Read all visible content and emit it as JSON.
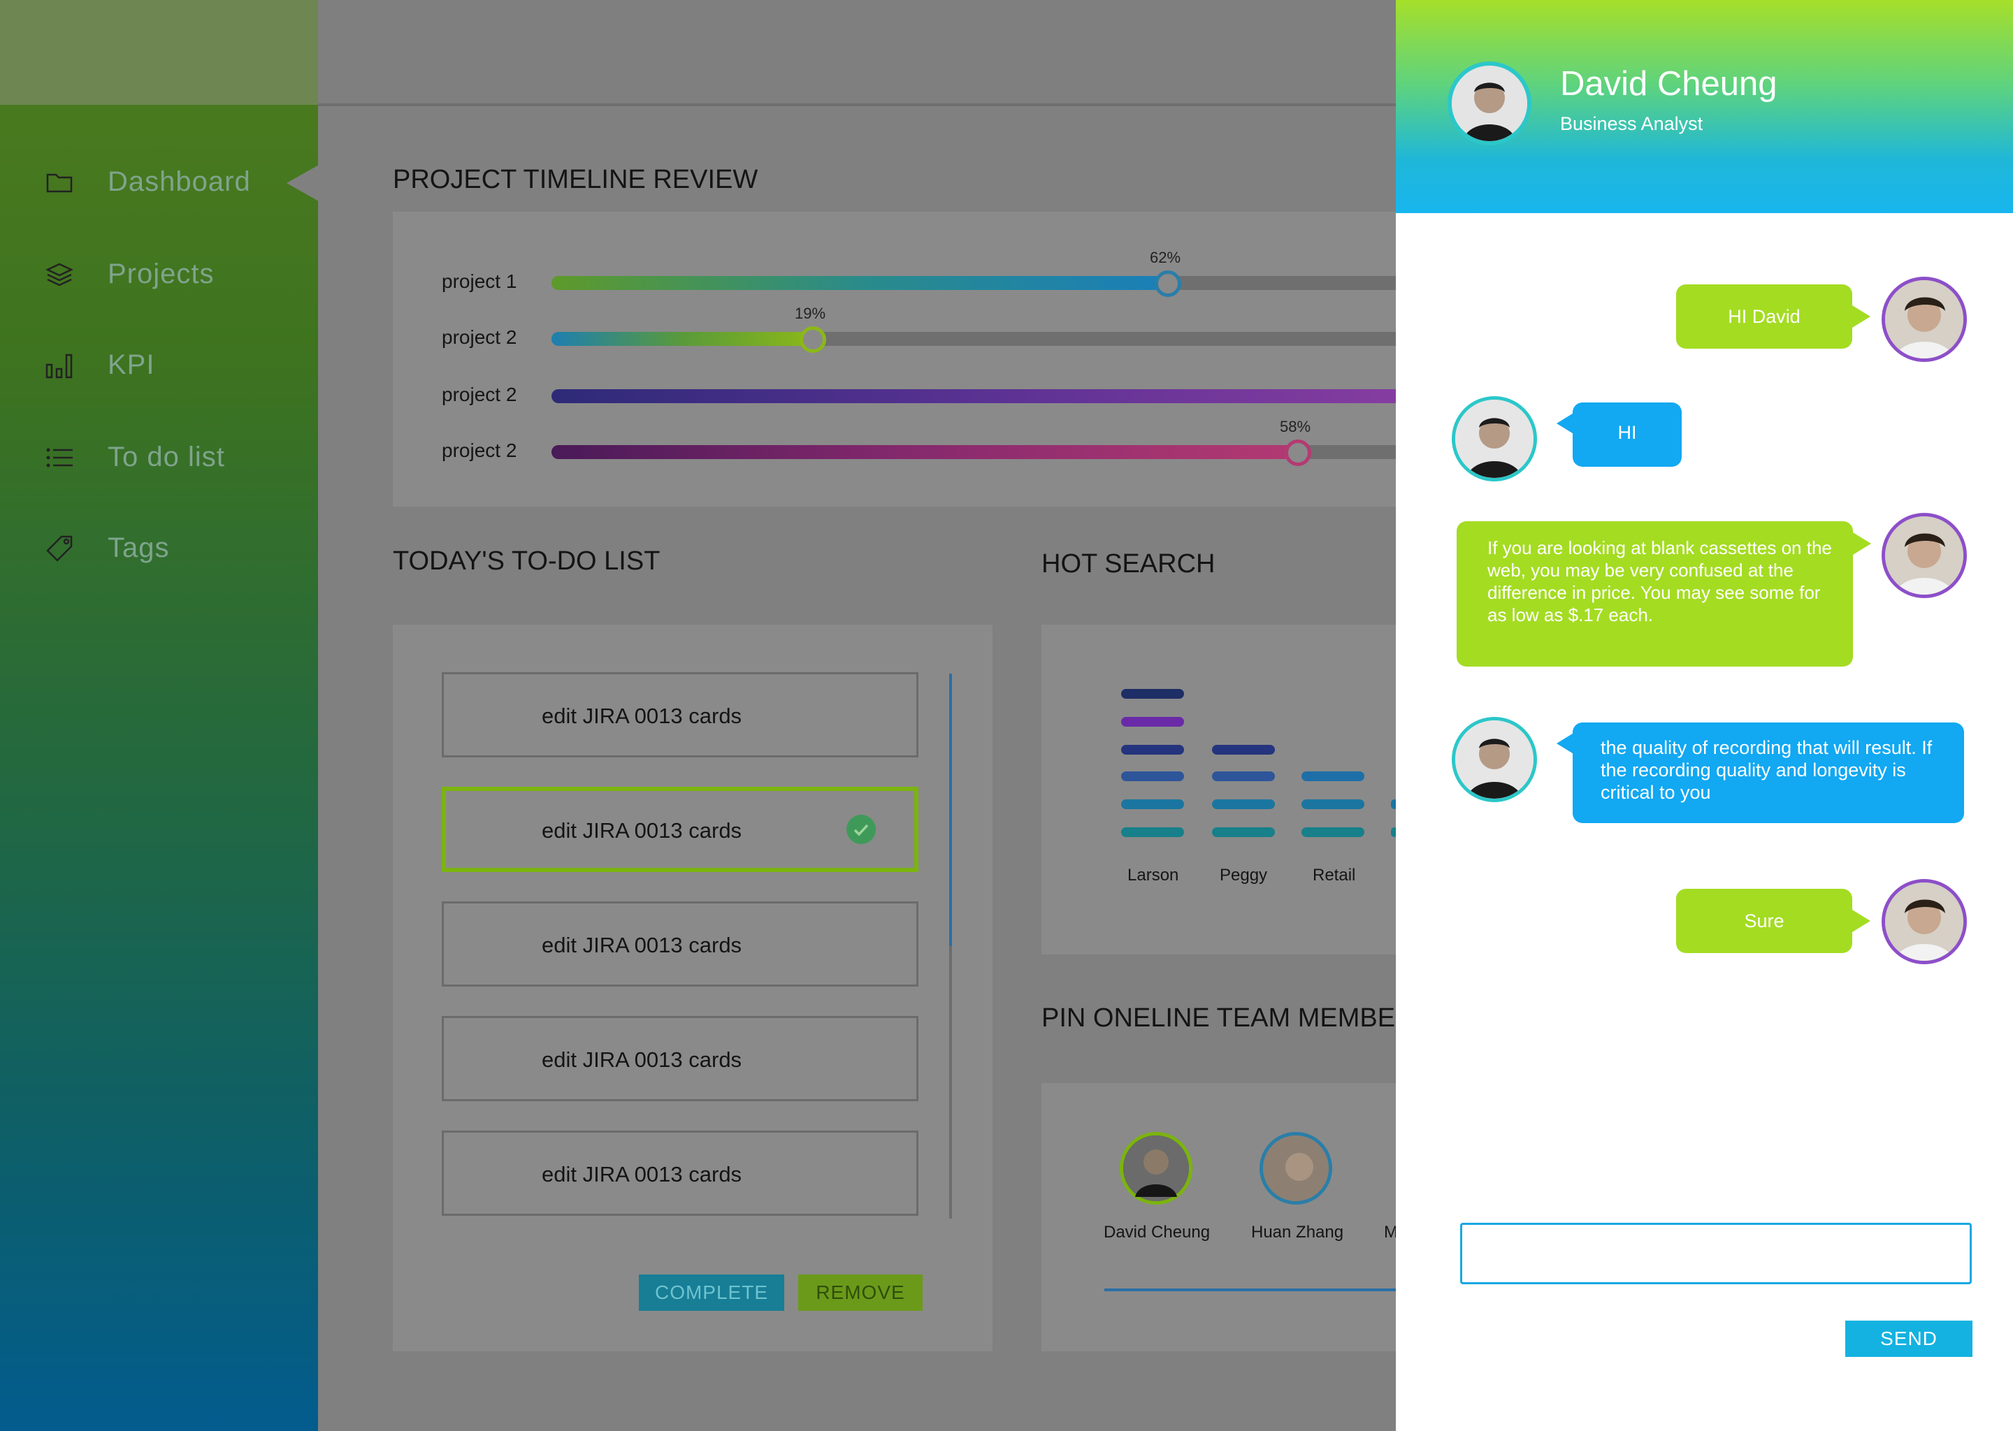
{
  "sidebar": {
    "items": [
      {
        "label": "Dashboard",
        "icon": "folder-icon"
      },
      {
        "label": "Projects",
        "icon": "layers-icon"
      },
      {
        "label": "KPI",
        "icon": "bar-chart-icon"
      },
      {
        "label": "To do list",
        "icon": "list-icon"
      },
      {
        "label": "Tags",
        "icon": "tag-icon"
      }
    ]
  },
  "timeline": {
    "title": "PROJECT TIMELINE REVIEW",
    "rows": [
      {
        "label": "project 1",
        "percent": 62,
        "percent_label": "62%"
      },
      {
        "label": "project 2",
        "percent": 19,
        "percent_label": "19%"
      },
      {
        "label": "project 2",
        "percent": 100,
        "percent_label": ""
      },
      {
        "label": "project 2",
        "percent": 58,
        "percent_label": "58%"
      }
    ]
  },
  "todo": {
    "title": "TODAY'S TO-DO LIST",
    "items": [
      {
        "text": "edit JIRA 0013 cards",
        "checked": false
      },
      {
        "text": "edit JIRA 0013 cards",
        "checked": true
      },
      {
        "text": "edit JIRA 0013 cards",
        "checked": false
      },
      {
        "text": "edit JIRA 0013 cards",
        "checked": false
      },
      {
        "text": "edit JIRA 0013 cards",
        "checked": false
      }
    ],
    "complete_label": "COMPLETE",
    "remove_label": "REMOVE"
  },
  "hot_search": {
    "title": "HOT SEARCH",
    "labels": [
      "Larson",
      "Peggy",
      "Retail"
    ]
  },
  "team": {
    "title": "PIN ONELINE TEAM MEMBER",
    "members": [
      {
        "name": "David Cheung"
      },
      {
        "name": "Huan Zhang"
      },
      {
        "name": "M"
      }
    ]
  },
  "chat": {
    "name": "David Cheung",
    "role": "Business Analyst",
    "messages": [
      {
        "from": "me",
        "text": "HI David"
      },
      {
        "from": "them",
        "text": "HI"
      },
      {
        "from": "me",
        "text": "If you are looking at blank cassettes on the web, you may be very confused at the difference in price. You may see some for as low as $.17 each."
      },
      {
        "from": "them",
        "text": "the quality of recording that will result. If the recording quality and longevity is critical to you"
      },
      {
        "from": "me",
        "text": "Sure"
      }
    ],
    "input_value": "",
    "send_label": "SEND"
  },
  "colors": {
    "accent_green": "#a4dc22",
    "accent_blue": "#12a8f2",
    "me_avatar_ring": "#8d4fc9",
    "them_avatar_ring": "#2cc7c9"
  }
}
